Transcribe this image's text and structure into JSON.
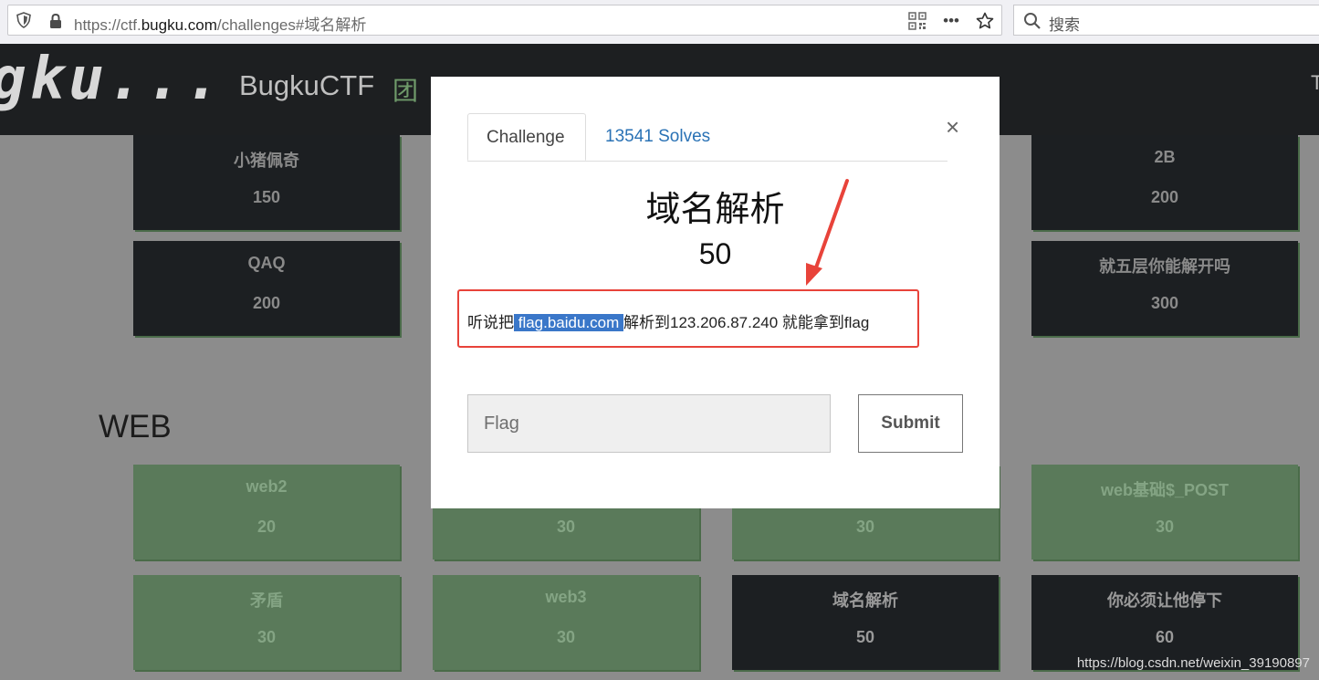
{
  "browser": {
    "url_prefix": "https://ctf.",
    "url_domain": "bugku.com",
    "url_suffix": "/challenges#域名解析",
    "qr_icon": "qr-code-icon",
    "more_label": "•••",
    "bookmark_icon": "star-icon",
    "search_placeholder": "搜索"
  },
  "site": {
    "logo": "gku...",
    "brand": "BugkuCTF",
    "nav_more": "团队",
    "nav_right": "T"
  },
  "cards_top": [
    {
      "title": "小猪佩奇",
      "points": "150"
    },
    {
      "title": "2B",
      "points": "200"
    },
    {
      "title": "QAQ",
      "points": "200"
    },
    {
      "title": "就五层你能解开吗",
      "points": "300"
    }
  ],
  "section": {
    "title": "WEB"
  },
  "cards_web": [
    {
      "title": "web2",
      "points": "20"
    },
    {
      "title": "",
      "points": "30"
    },
    {
      "title": "",
      "points": "30"
    },
    {
      "title": "web基础$_POST",
      "points": "30"
    },
    {
      "title": "矛盾",
      "points": "30"
    },
    {
      "title": "web3",
      "points": "30"
    },
    {
      "title": "域名解析",
      "points": "50"
    },
    {
      "title": "你必须让他停下",
      "points": "60"
    }
  ],
  "modal": {
    "tab_challenge": "Challenge",
    "tab_solves": "13541 Solves",
    "close_label": "×",
    "title": "域名解析",
    "points": "50",
    "desc_before": "听说把",
    "desc_selected": " flag.baidu.com ",
    "desc_after": "解析到123.206.87.240 就能拿到flag",
    "flag_placeholder": "Flag",
    "submit_label": "Submit"
  },
  "watermark": "https://blog.csdn.net/weixin_39190897",
  "colors": {
    "annotation_red": "#e8433a",
    "link_blue": "#2a72b5",
    "card_dark": "#1c1f22",
    "card_green": "#5a7a5a"
  }
}
